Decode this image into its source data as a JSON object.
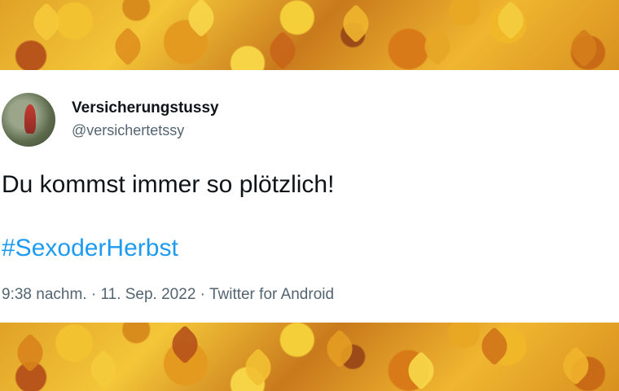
{
  "tweet": {
    "display_name": "Versicherungstussy",
    "handle": "@versichertetssy",
    "text": "Du kommst immer so plötzlich!",
    "hashtag": "#SexoderHerbst",
    "time": "9:38 nachm.",
    "separator": " · ",
    "date": "11. Sep. 2022",
    "source": "Twitter for Android"
  },
  "colors": {
    "text": "#0f1419",
    "secondary": "#536471",
    "link": "#1d9bf0"
  }
}
